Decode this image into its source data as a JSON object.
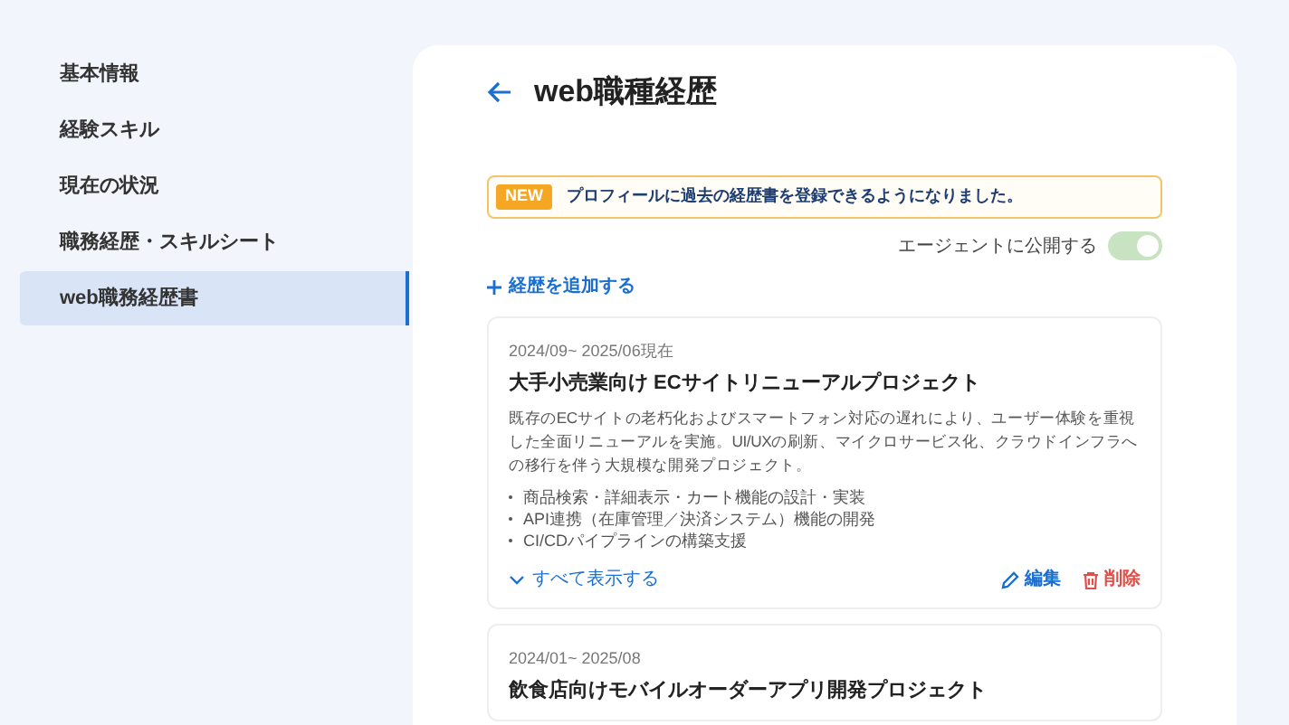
{
  "sidebar": {
    "items": [
      {
        "label": "基本情報",
        "selected": false
      },
      {
        "label": "経験スキル",
        "selected": false
      },
      {
        "label": "現在の状況",
        "selected": false
      },
      {
        "label": "職務経歴・スキルシート",
        "selected": false
      },
      {
        "label": "web職務経歴書",
        "selected": true
      }
    ]
  },
  "page": {
    "title": "web職種経歴"
  },
  "notice": {
    "badge": "NEW",
    "text": "プロフィールに過去の経歴書を登録できるようになりました。"
  },
  "publish_toggle": {
    "label": "エージェントに公開する",
    "on": true
  },
  "add_link": {
    "label": "経歴を追加する"
  },
  "projects": [
    {
      "period": "2024/09~ 2025/06現在",
      "title": "大手小売業向け ECサイトリニューアルプロジェクト",
      "description": "既存のECサイトの老朽化およびスマートフォン対応の遅れにより、ユーザー体験を重視した全面リニューアルを実施。UI/UXの刷新、マイクロサービス化、クラウドインフラへの移行を伴う大規模な開発プロジェクト。",
      "bullets": [
        "商品検索・詳細表示・カート機能の設計・実装",
        "API連携（在庫管理／決済システム）機能の開発",
        "CI/CDパイプラインの構築支援"
      ],
      "show_all": "すべて表示する",
      "edit": "編集",
      "delete": "削除"
    },
    {
      "period": "2024/01~ 2025/08",
      "title": "飲食店向けモバイルオーダーアプリ開発プロジェクト"
    }
  ]
}
